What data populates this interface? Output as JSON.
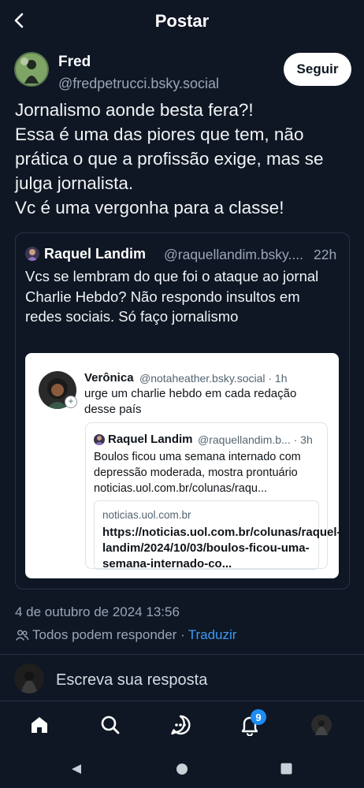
{
  "header": {
    "title": "Postar"
  },
  "post": {
    "author_name": "Fred",
    "author_handle": "@fredpetrucci.bsky.social",
    "follow_label": "Seguir",
    "text": "Jornalismo aonde besta fera?!\nEssa é uma das piores que tem, não prática o que a profissão exige, mas se julga jornalista.\nVc é uma vergonha para a classe!"
  },
  "quote": {
    "author_name": "Raquel Landim",
    "author_handle": "@raquellandim.bsky....",
    "time": "22h",
    "text": "Vcs se lembram do que foi o ataque ao jornal Charlie Hebdo? Não respondo insultos em redes sociais. Só faço jornalismo",
    "embed": {
      "author_name": "Verônica",
      "author_handle": "@notaheather.bsky.social · 1h",
      "text": "urge um charlie hebdo em cada redação desse país",
      "inner": {
        "author_name": "Raquel Landim",
        "author_handle": "@raquellandim.b... · 3h",
        "text": "Boulos ficou uma semana internado com depressão moderada, mostra prontuário noticias.uol.com.br/colunas/raqu...",
        "link_domain": "noticias.uol.com.br",
        "link_title": "https://noticias.uol.com.br/colunas/raquel-landim/2024/10/03/boulos-ficou-uma-semana-internado-co..."
      }
    }
  },
  "meta": {
    "date": "4 de outubro de 2024 13:56",
    "reply_setting": "Todos podem responder ·",
    "translate_label": "Traduzir"
  },
  "compose": {
    "placeholder": "Escreva sua resposta"
  },
  "nav": {
    "notif_count": "9"
  },
  "colors": {
    "background": "#0f1724",
    "accent": "#1d8cf5",
    "link": "#3b9af5"
  }
}
